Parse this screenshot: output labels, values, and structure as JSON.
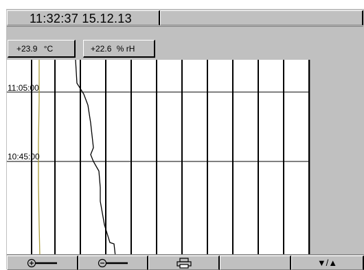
{
  "header": {
    "clock": "11:32:37  15.12.13"
  },
  "readings": [
    {
      "value": "+23.9",
      "unit": "°C"
    },
    {
      "value": "+22.6",
      "unit": "% rH"
    }
  ],
  "chart_data": {
    "type": "line",
    "y_axis_labels": [
      "11:05:00",
      "10:45:00"
    ],
    "series": [
      {
        "color": "#a89a3a",
        "points": [
          [
            47,
            0
          ],
          [
            47,
            60
          ],
          [
            46,
            120
          ],
          [
            46,
            180
          ],
          [
            47,
            240
          ],
          [
            48,
            286
          ]
        ]
      },
      {
        "color": "#000000",
        "points": [
          [
            100,
            0
          ],
          [
            102,
            34
          ],
          [
            112,
            50
          ],
          [
            118,
            66
          ],
          [
            122,
            92
          ],
          [
            126,
            128
          ],
          [
            122,
            138
          ],
          [
            126,
            148
          ],
          [
            134,
            162
          ],
          [
            136,
            186
          ],
          [
            136,
            206
          ],
          [
            142,
            240
          ],
          [
            150,
            266
          ],
          [
            156,
            268
          ],
          [
            158,
            286
          ]
        ]
      }
    ]
  },
  "toolbar": {
    "buttons": [
      {
        "icon": "zoom-in-icon"
      },
      {
        "icon": "zoom-out-icon"
      },
      {
        "icon": "print-icon"
      },
      {
        "icon": "blank"
      },
      {
        "label": "▼/▲"
      }
    ]
  }
}
